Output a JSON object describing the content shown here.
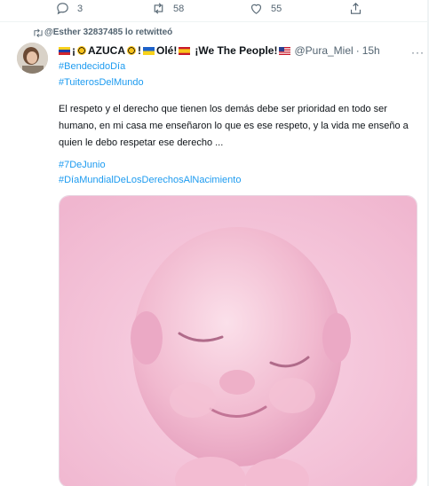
{
  "prev_tweet_actions": {
    "reply_count": "3",
    "retweet_count": "58",
    "like_count": "55",
    "icons": [
      "reply-icon",
      "retweet-icon",
      "like-icon",
      "share-icon"
    ]
  },
  "retweet_context": {
    "text": "@Esther 32837485 lo retwitteó",
    "icon": "retweet-icon"
  },
  "tweet": {
    "author": {
      "name_prefix": "¡",
      "name_main": "AZUCA",
      "name_mid": "!",
      "name_ole": "Olé!",
      "name_tail": "¡We The People!",
      "handle": "@Pura_Miel",
      "separator": "·",
      "time": "15h"
    },
    "more_label": "···",
    "hashtags_top": [
      "#BendecidoDía",
      "#TuiterosDelMundo"
    ],
    "body": "El respeto y el derecho que tienen los demás debe ser prioridad en todo ser humano, en mi casa me enseñaron lo que es ese respeto, y la vida me enseño a quien le debo respetar ese derecho ...",
    "hashtags_bottom": [
      "#7DeJunio",
      "#DíaMundialDeLosDerechosAlNacimiento"
    ],
    "media": {
      "alt": "baby",
      "background": "#f4c6dc"
    }
  },
  "colors": {
    "link": "#1d9bf0",
    "secondary": "#536471",
    "text": "#0f1419"
  }
}
